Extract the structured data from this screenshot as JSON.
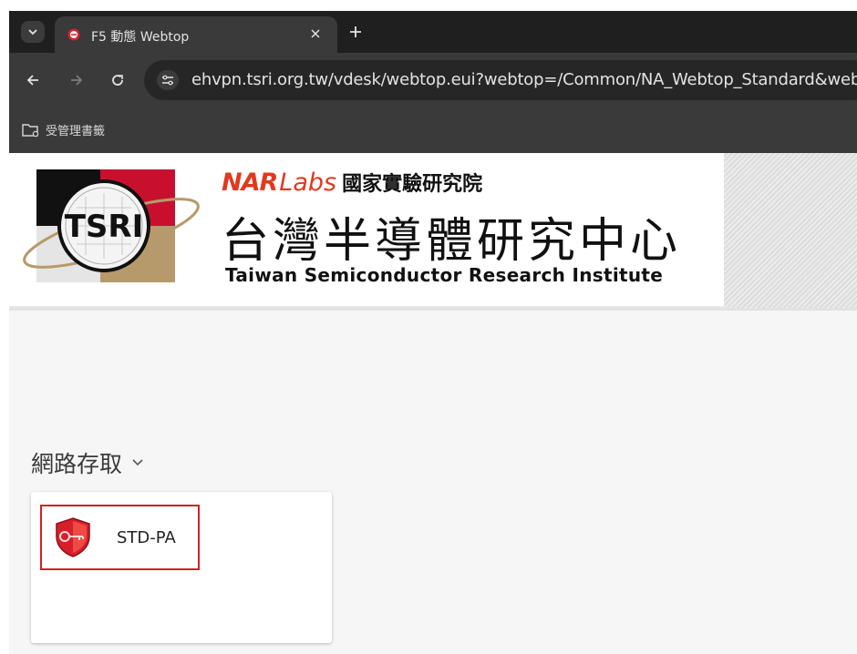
{
  "browser": {
    "tab_title": "F5 動態 Webtop",
    "url": "ehvpn.tsri.org.tw/vdesk/webtop.eui?webtop=/Common/NA_Webtop_Standard&webtop_type=webtop_full",
    "bookmark_label": "受管理書籤",
    "icons": {
      "tab_search": "chevron-down-icon",
      "close": "close-icon",
      "new_tab": "plus-icon",
      "back": "arrow-left-icon",
      "forward": "arrow-right-icon",
      "reload": "reload-icon",
      "site_info": "tune-icon",
      "bookmark_folder": "managed-folder-icon"
    }
  },
  "banner": {
    "logo_text": "TSRI",
    "nar": "NAR",
    "labs": "Labs",
    "nar_cn": "國家實驗研究院",
    "org_cn": "台灣半導體研究中心",
    "org_en": "Taiwan Semiconductor Research Institute"
  },
  "section": {
    "title": "網路存取",
    "toggle_icon": "chevron-down-icon"
  },
  "resources": [
    {
      "name": "STD-PA",
      "icon": "shield-key-icon"
    }
  ],
  "colors": {
    "accent": "#e03a1e",
    "highlight_border": "#d21f2c",
    "chrome_dark": "#1f1f1f",
    "chrome_mid": "#3a3a3a"
  }
}
